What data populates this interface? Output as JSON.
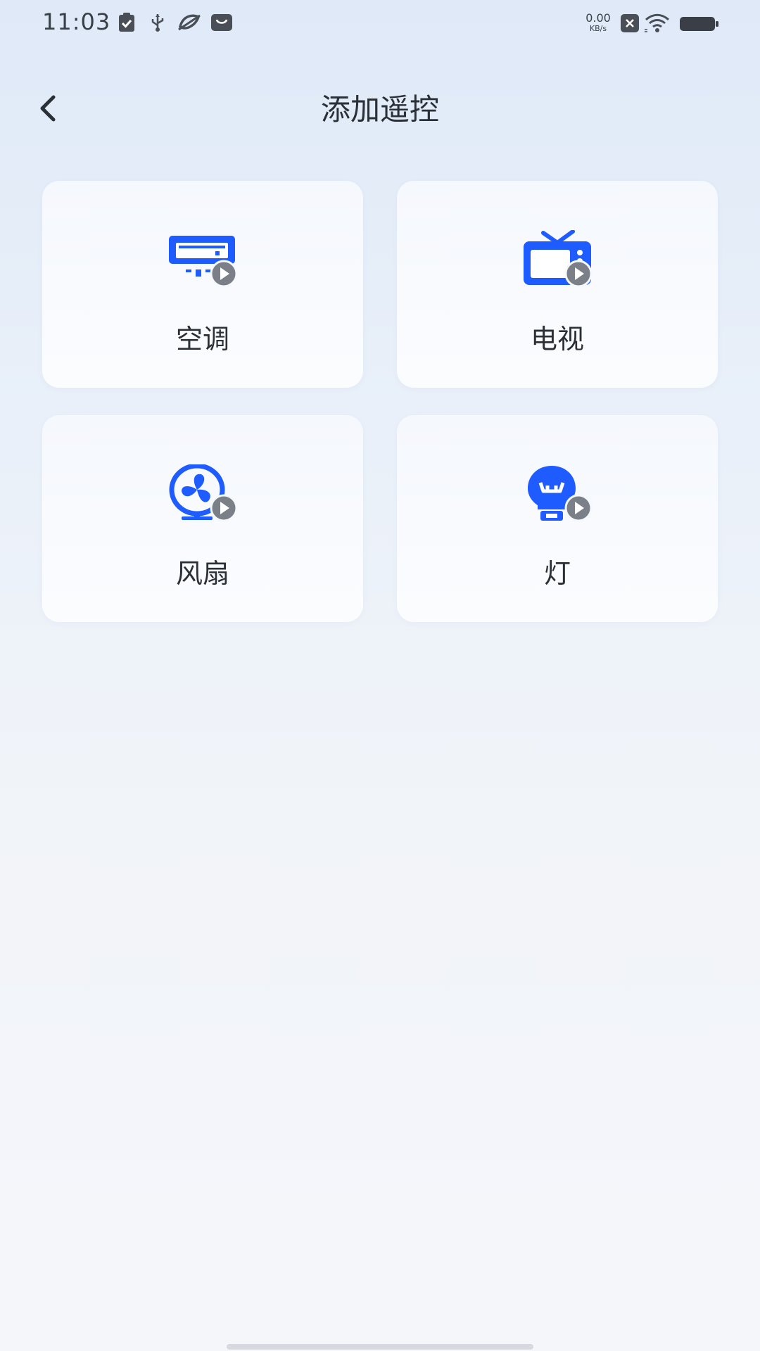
{
  "status_bar": {
    "time": "11:03",
    "net_speed_value": "0.00",
    "net_speed_unit": "KB/s",
    "icons": [
      "clipboard-check-icon",
      "usb-icon",
      "link-icon",
      "shopping-bag-icon",
      "close-box-icon",
      "wifi-icon",
      "battery-icon"
    ]
  },
  "header": {
    "back_icon": "chevron-left-icon",
    "title": "添加遥控"
  },
  "devices": [
    {
      "label": "空调",
      "icon": "air-conditioner-icon"
    },
    {
      "label": "电视",
      "icon": "tv-icon"
    },
    {
      "label": "风扇",
      "icon": "fan-icon"
    },
    {
      "label": "灯",
      "icon": "light-bulb-icon"
    }
  ],
  "colors": {
    "accent": "#1f5cff",
    "play_badge": "#7a7f88",
    "text": "#2b2f36"
  }
}
